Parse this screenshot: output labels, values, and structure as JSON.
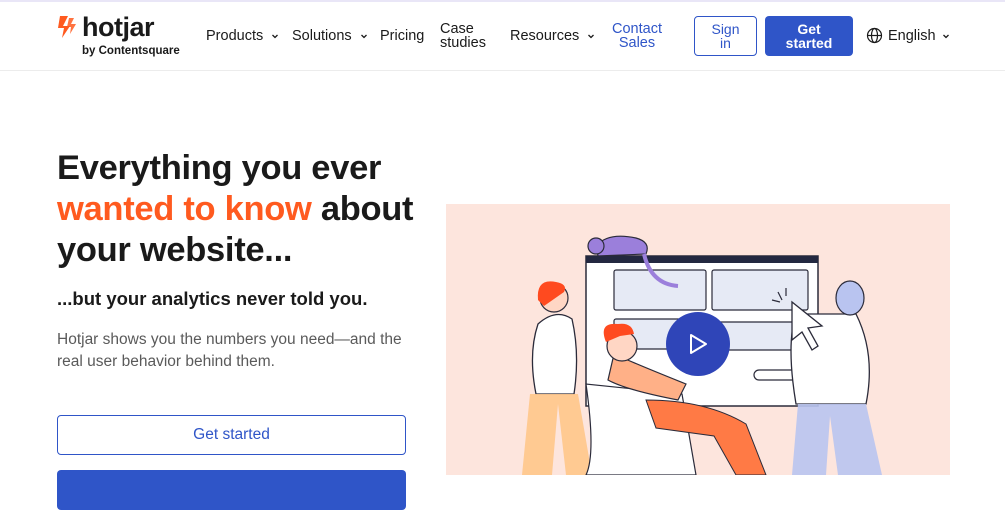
{
  "brand": {
    "name": "hotjar",
    "byline": "by Contentsquare",
    "accent": "#ff5a1f",
    "primary": "#2f55c8"
  },
  "nav": {
    "products": "Products",
    "solutions": "Solutions",
    "pricing": "Pricing",
    "case_studies_1": "Case",
    "case_studies_2": "studies",
    "resources": "Resources",
    "contact_1": "Contact",
    "contact_2": "Sales",
    "sign_in_1": "Sign",
    "sign_in_2": "in",
    "get_started_1": "Get",
    "get_started_2": "started",
    "language": "English"
  },
  "hero": {
    "line1": "Everything you ever",
    "accent": "wanted to know",
    "line2_rest": " about",
    "line3": "your website...",
    "subheadline": "...but your analytics never told you.",
    "description": "Hotjar shows you the numbers you need—and the real user behavior behind them.",
    "cta_outline": "Get started"
  },
  "illustration": {
    "play_icon": "play-icon",
    "background": "#fde5dd"
  }
}
